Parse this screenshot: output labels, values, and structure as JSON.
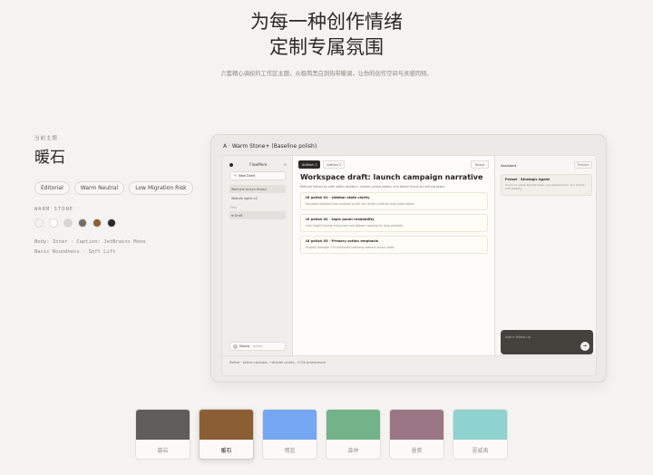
{
  "hero": {
    "eyebrow": "—— ——",
    "title_line1": "为每一种创作情绪",
    "title_line2": "定制专属氛围",
    "subtitle": "六套精心调校的工作区主题，从极简黑白到热带暖调，让你的创作空间与灵感同频。"
  },
  "current_theme": {
    "kicker": "当前主题",
    "name": "暖石",
    "chips": [
      "Editorial",
      "Warm Neutral",
      "Low Migration Risk"
    ],
    "palette_label": "WARM STONE",
    "swatches": [
      "#f4f3f1",
      "#ffffff",
      "#d8d6d2",
      "#6f6e6b",
      "#8b5e34",
      "#2b2a28"
    ],
    "font_line": "Body: Inter · Caption: JetBrains Mono",
    "detail_line": "Basic Roundness · Soft Lift"
  },
  "preview": {
    "window_title": "A · Warm Stone+ (Baseline polish)",
    "sidebar": {
      "brand": "FlowMore",
      "brand_icon": "⊡",
      "new_draft": "New Draft",
      "items": [
        "Warmine launch thread",
        "Website agent v2"
      ],
      "group": "Files",
      "group_items": [
        "⊞ Draft"
      ],
      "user_name": "Marina",
      "user_status": "· active"
    },
    "main": {
      "tabs": [
        "Artifact 1",
        "Artifact 2"
      ],
      "share": "Share",
      "title": "Workspace draft: launch campaign narrative",
      "description": "Refined hierarchy with softer dividers, clearer active states, and better focus for writing tasks.",
      "cards": [
        {
          "title": "UI polish 01 · sidebar state clarity",
          "desc": "Elevated selected row contrast so the key writer surfaces read more easier."
        },
        {
          "title": "UI polish 02 · topic panel readability",
          "desc": "Line-height normal rhtax text and deeper spacing for long prompts."
        },
        {
          "title": "UI polish 03 · Primary action emphasis",
          "desc": "Slightly stronger CTA improves scanning without visual noise."
        }
      ]
    },
    "assistant": {
      "title": "Assistant",
      "button": "Preview",
      "prompt_title": "Preset · Strategic Agent",
      "prompt_desc": "Focus on value against ways, and appearance, and choice CTA polarity.",
      "input_placeholder": "Add a follow-up",
      "send_icon": "➜"
    },
    "status": "Refine · active contrast, +divider clarity, +CTA prominence"
  },
  "themes": [
    {
      "label": "暮岩",
      "color": "#5e5d5b",
      "active": false
    },
    {
      "label": "暖石",
      "color": "#8b5e34",
      "active": true
    },
    {
      "label": "晴蓝",
      "color": "#76a7f2",
      "active": false
    },
    {
      "label": "森林",
      "color": "#73b38a",
      "active": false
    },
    {
      "label": "墨紫",
      "color": "#9b7685",
      "active": false
    },
    {
      "label": "夏威夷",
      "color": "#8fd3d0",
      "active": false
    }
  ]
}
